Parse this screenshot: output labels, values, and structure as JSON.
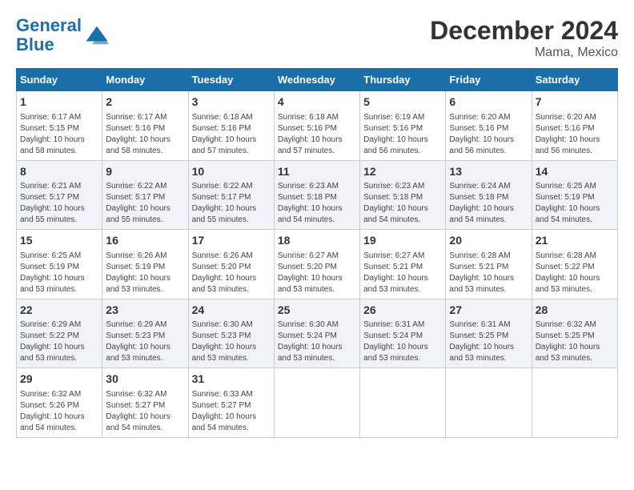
{
  "header": {
    "logo_line1": "General",
    "logo_line2": "Blue",
    "title": "December 2024",
    "subtitle": "Mama, Mexico"
  },
  "columns": [
    "Sunday",
    "Monday",
    "Tuesday",
    "Wednesday",
    "Thursday",
    "Friday",
    "Saturday"
  ],
  "weeks": [
    [
      {
        "day": "1",
        "info": "Sunrise: 6:17 AM\nSunset: 5:15 PM\nDaylight: 10 hours\nand 58 minutes."
      },
      {
        "day": "2",
        "info": "Sunrise: 6:17 AM\nSunset: 5:16 PM\nDaylight: 10 hours\nand 58 minutes."
      },
      {
        "day": "3",
        "info": "Sunrise: 6:18 AM\nSunset: 5:16 PM\nDaylight: 10 hours\nand 57 minutes."
      },
      {
        "day": "4",
        "info": "Sunrise: 6:18 AM\nSunset: 5:16 PM\nDaylight: 10 hours\nand 57 minutes."
      },
      {
        "day": "5",
        "info": "Sunrise: 6:19 AM\nSunset: 5:16 PM\nDaylight: 10 hours\nand 56 minutes."
      },
      {
        "day": "6",
        "info": "Sunrise: 6:20 AM\nSunset: 5:16 PM\nDaylight: 10 hours\nand 56 minutes."
      },
      {
        "day": "7",
        "info": "Sunrise: 6:20 AM\nSunset: 5:16 PM\nDaylight: 10 hours\nand 56 minutes."
      }
    ],
    [
      {
        "day": "8",
        "info": "Sunrise: 6:21 AM\nSunset: 5:17 PM\nDaylight: 10 hours\nand 55 minutes."
      },
      {
        "day": "9",
        "info": "Sunrise: 6:22 AM\nSunset: 5:17 PM\nDaylight: 10 hours\nand 55 minutes."
      },
      {
        "day": "10",
        "info": "Sunrise: 6:22 AM\nSunset: 5:17 PM\nDaylight: 10 hours\nand 55 minutes."
      },
      {
        "day": "11",
        "info": "Sunrise: 6:23 AM\nSunset: 5:18 PM\nDaylight: 10 hours\nand 54 minutes."
      },
      {
        "day": "12",
        "info": "Sunrise: 6:23 AM\nSunset: 5:18 PM\nDaylight: 10 hours\nand 54 minutes."
      },
      {
        "day": "13",
        "info": "Sunrise: 6:24 AM\nSunset: 5:18 PM\nDaylight: 10 hours\nand 54 minutes."
      },
      {
        "day": "14",
        "info": "Sunrise: 6:25 AM\nSunset: 5:19 PM\nDaylight: 10 hours\nand 54 minutes."
      }
    ],
    [
      {
        "day": "15",
        "info": "Sunrise: 6:25 AM\nSunset: 5:19 PM\nDaylight: 10 hours\nand 53 minutes."
      },
      {
        "day": "16",
        "info": "Sunrise: 6:26 AM\nSunset: 5:19 PM\nDaylight: 10 hours\nand 53 minutes."
      },
      {
        "day": "17",
        "info": "Sunrise: 6:26 AM\nSunset: 5:20 PM\nDaylight: 10 hours\nand 53 minutes."
      },
      {
        "day": "18",
        "info": "Sunrise: 6:27 AM\nSunset: 5:20 PM\nDaylight: 10 hours\nand 53 minutes."
      },
      {
        "day": "19",
        "info": "Sunrise: 6:27 AM\nSunset: 5:21 PM\nDaylight: 10 hours\nand 53 minutes."
      },
      {
        "day": "20",
        "info": "Sunrise: 6:28 AM\nSunset: 5:21 PM\nDaylight: 10 hours\nand 53 minutes."
      },
      {
        "day": "21",
        "info": "Sunrise: 6:28 AM\nSunset: 5:22 PM\nDaylight: 10 hours\nand 53 minutes."
      }
    ],
    [
      {
        "day": "22",
        "info": "Sunrise: 6:29 AM\nSunset: 5:22 PM\nDaylight: 10 hours\nand 53 minutes."
      },
      {
        "day": "23",
        "info": "Sunrise: 6:29 AM\nSunset: 5:23 PM\nDaylight: 10 hours\nand 53 minutes."
      },
      {
        "day": "24",
        "info": "Sunrise: 6:30 AM\nSunset: 5:23 PM\nDaylight: 10 hours\nand 53 minutes."
      },
      {
        "day": "25",
        "info": "Sunrise: 6:30 AM\nSunset: 5:24 PM\nDaylight: 10 hours\nand 53 minutes."
      },
      {
        "day": "26",
        "info": "Sunrise: 6:31 AM\nSunset: 5:24 PM\nDaylight: 10 hours\nand 53 minutes."
      },
      {
        "day": "27",
        "info": "Sunrise: 6:31 AM\nSunset: 5:25 PM\nDaylight: 10 hours\nand 53 minutes."
      },
      {
        "day": "28",
        "info": "Sunrise: 6:32 AM\nSunset: 5:25 PM\nDaylight: 10 hours\nand 53 minutes."
      }
    ],
    [
      {
        "day": "29",
        "info": "Sunrise: 6:32 AM\nSunset: 5:26 PM\nDaylight: 10 hours\nand 54 minutes."
      },
      {
        "day": "30",
        "info": "Sunrise: 6:32 AM\nSunset: 5:27 PM\nDaylight: 10 hours\nand 54 minutes."
      },
      {
        "day": "31",
        "info": "Sunrise: 6:33 AM\nSunset: 5:27 PM\nDaylight: 10 hours\nand 54 minutes."
      },
      {
        "day": "",
        "info": ""
      },
      {
        "day": "",
        "info": ""
      },
      {
        "day": "",
        "info": ""
      },
      {
        "day": "",
        "info": ""
      }
    ]
  ]
}
